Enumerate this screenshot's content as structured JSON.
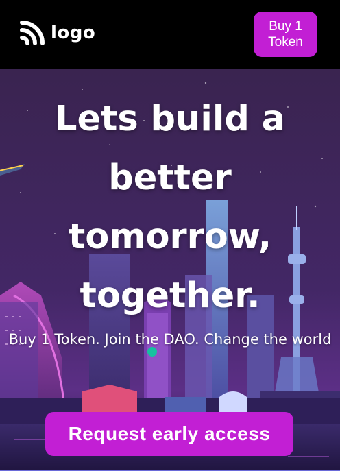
{
  "header": {
    "logo_text": "logo",
    "buy_button_line1": "Buy 1",
    "buy_button_line2": "Token"
  },
  "hero": {
    "headline_line1": "Lets build a",
    "headline_line2": "better",
    "headline_line3": "tomorrow,",
    "headline_line4": "together.",
    "subline": "Buy 1 Token. Join the DAO. Change the world",
    "cta_label": "Request early access"
  },
  "colors": {
    "accent": "#c21fd4",
    "header_bg": "#000000",
    "text": "#ffffff"
  },
  "icons": {
    "logo": "rss-feed-icon"
  }
}
